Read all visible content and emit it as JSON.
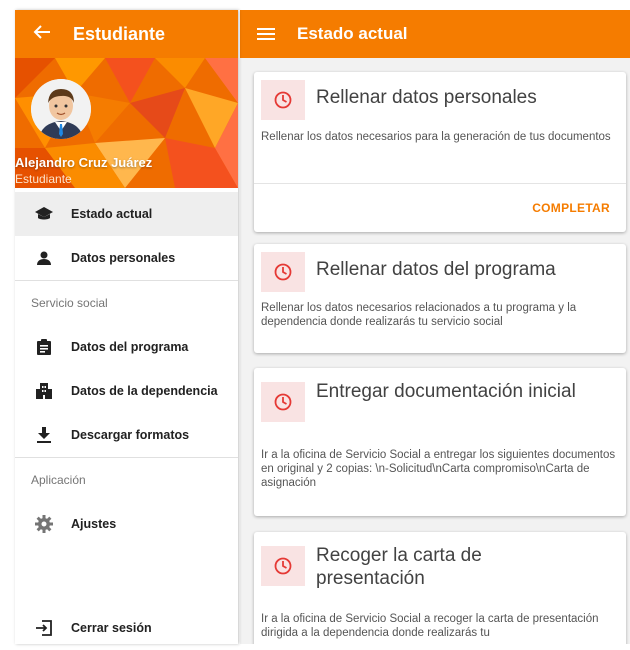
{
  "colors": {
    "accent": "#f57c00",
    "active_bg": "#eeeeee",
    "icon_bg": "#f9e3e3",
    "icon_red": "#e53935"
  },
  "drawer": {
    "title": "Estudiante",
    "back_icon": "arrow-left-icon",
    "user": {
      "name": "Alejandro Cruz Juárez",
      "role": "Estudiante"
    },
    "items": [
      {
        "label": "Estado actual",
        "icon": "graduation-cap-icon",
        "active": true
      },
      {
        "label": "Datos personales",
        "icon": "person-icon",
        "active": false
      }
    ],
    "section_social": "Servicio social",
    "social_items": [
      {
        "label": "Datos del programa",
        "icon": "assignment-icon"
      },
      {
        "label": "Datos de la dependencia",
        "icon": "building-icon"
      },
      {
        "label": "Descargar formatos",
        "icon": "download-icon"
      }
    ],
    "section_app": "Aplicación",
    "app_items": [
      {
        "label": "Ajustes",
        "icon": "gear-icon"
      }
    ],
    "logout": {
      "label": "Cerrar sesión",
      "icon": "logout-icon"
    }
  },
  "main": {
    "title": "Estado actual",
    "menu_icon": "hamburger-menu-icon",
    "cards": [
      {
        "title": "Rellenar datos personales",
        "description": "Rellenar los datos necesarios para la generación de tus documentos",
        "action": "COMPLETAR",
        "icon": "clock-icon"
      },
      {
        "title": "Rellenar datos del programa",
        "description": "Rellenar los datos necesarios relacionados a tu programa y la dependencia donde realizarás tu servicio social",
        "icon": "clock-icon"
      },
      {
        "title": "Entregar documentación inicial",
        "description": "Ir a la oficina de Servicio Social a entregar los siguientes documentos en original y 2 copias: \\n-Solicitud\\nCarta compromiso\\nCarta de asignación",
        "icon": "clock-icon"
      },
      {
        "title": "Recoger la carta de presentación",
        "description": "Ir a la oficina de Servicio Social a recoger la carta de presentación dirigida a la dependencia donde realizarás tu",
        "icon": "clock-icon"
      }
    ]
  }
}
